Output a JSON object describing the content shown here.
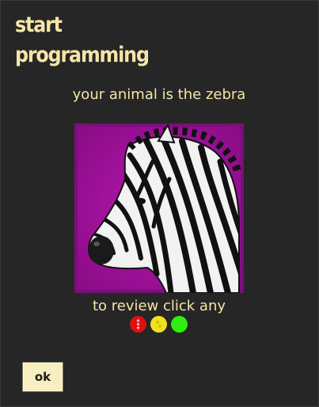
{
  "dialog": {
    "title_line1": "start",
    "title_line2": "programming",
    "animal_message": "your animal is the zebra",
    "animal_image_icon": "zebra-image",
    "review_prompt": "to review click any",
    "review_buttons": [
      {
        "icon": "red-dot-icon",
        "color": "#e01010"
      },
      {
        "icon": "yellow-dot-icon",
        "color": "#f0e020"
      },
      {
        "icon": "green-dot-icon",
        "color": "#30ee10"
      }
    ],
    "ok_label": "ok"
  },
  "colors": {
    "background": "#262626",
    "text": "#f5e6a8",
    "image_background": "#a4109f",
    "button_background": "#f8efc0"
  }
}
